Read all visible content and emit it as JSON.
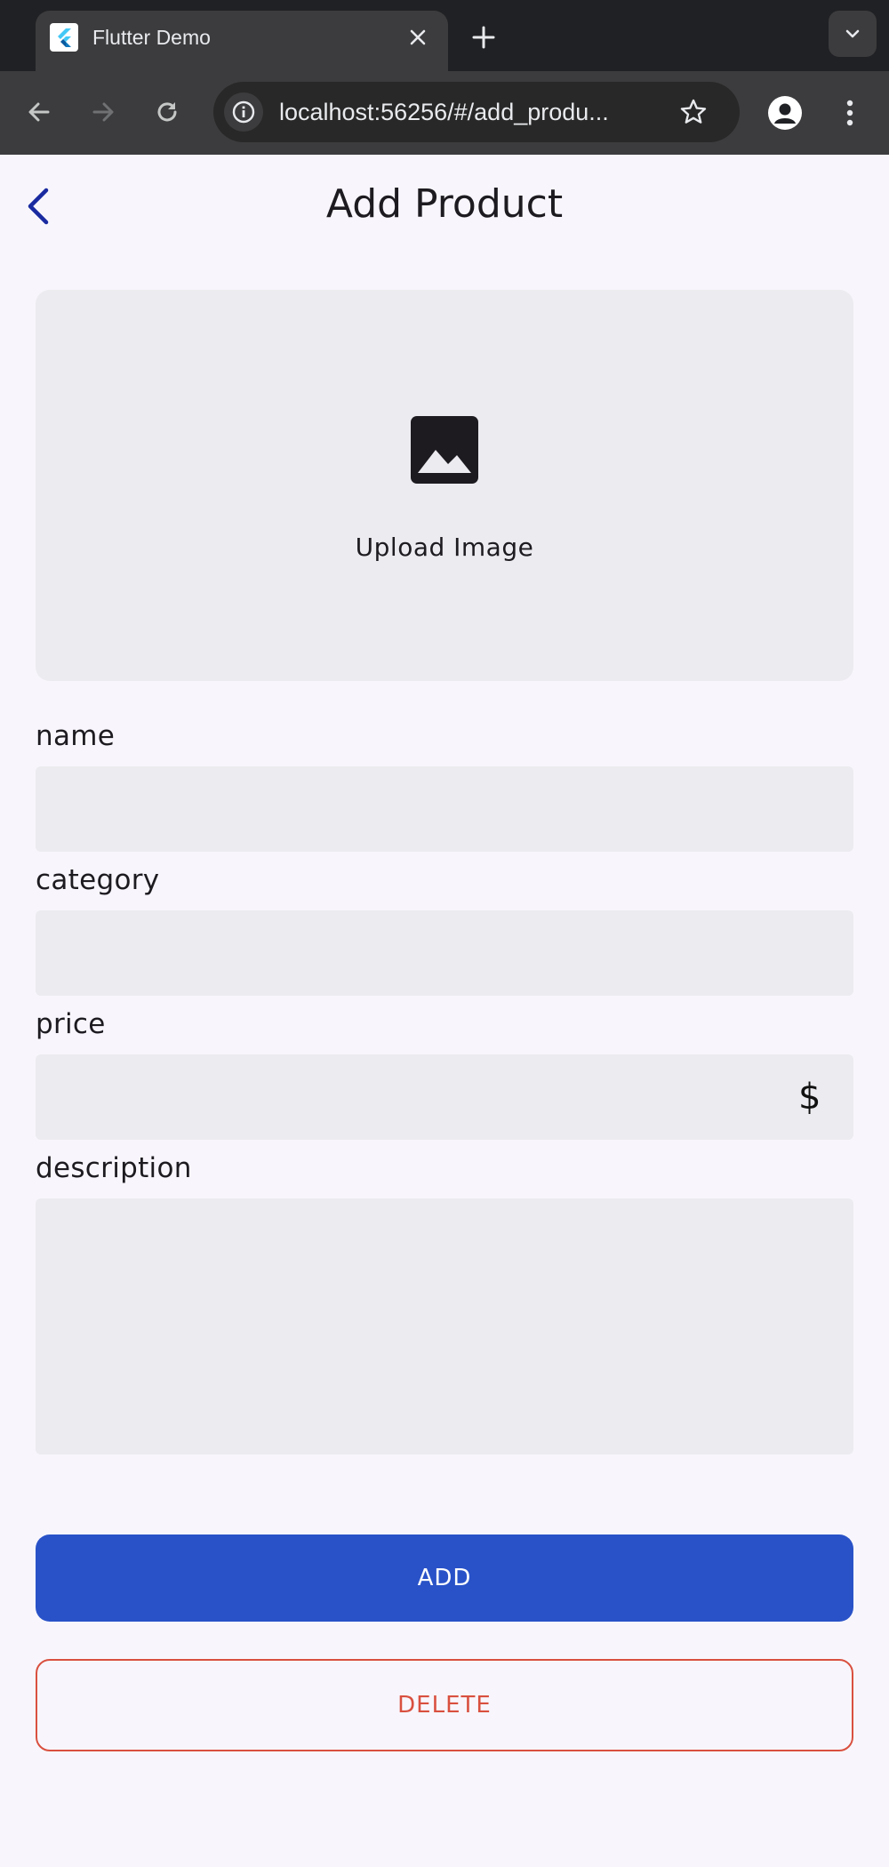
{
  "browser": {
    "tab": {
      "title": "Flutter Demo",
      "favicon": "flutter-logo"
    },
    "url": "localhost:56256/#/add_produ...",
    "icons": [
      "back-arrow-icon",
      "forward-arrow-icon",
      "reload-icon",
      "info-icon",
      "star-icon",
      "profile-icon",
      "kebab-menu-icon",
      "chevron-down-icon",
      "plus-icon",
      "close-icon"
    ]
  },
  "appbar": {
    "title": "Add Product",
    "back_icon": "chevron-left-icon"
  },
  "upload": {
    "label": "Upload Image",
    "icon": "image-icon"
  },
  "form": {
    "name": {
      "label": "name",
      "value": ""
    },
    "category": {
      "label": "category",
      "value": ""
    },
    "price": {
      "label": "price",
      "value": "",
      "suffix": "$"
    },
    "description": {
      "label": "description",
      "value": ""
    }
  },
  "actions": {
    "add_label": "ADD",
    "delete_label": "DELETE"
  },
  "colors": {
    "primary": "#2952c8",
    "danger": "#d9503f",
    "background": "#f8f6fc",
    "field_fill": "#ecebef",
    "back_icon": "#1a2aa0"
  }
}
